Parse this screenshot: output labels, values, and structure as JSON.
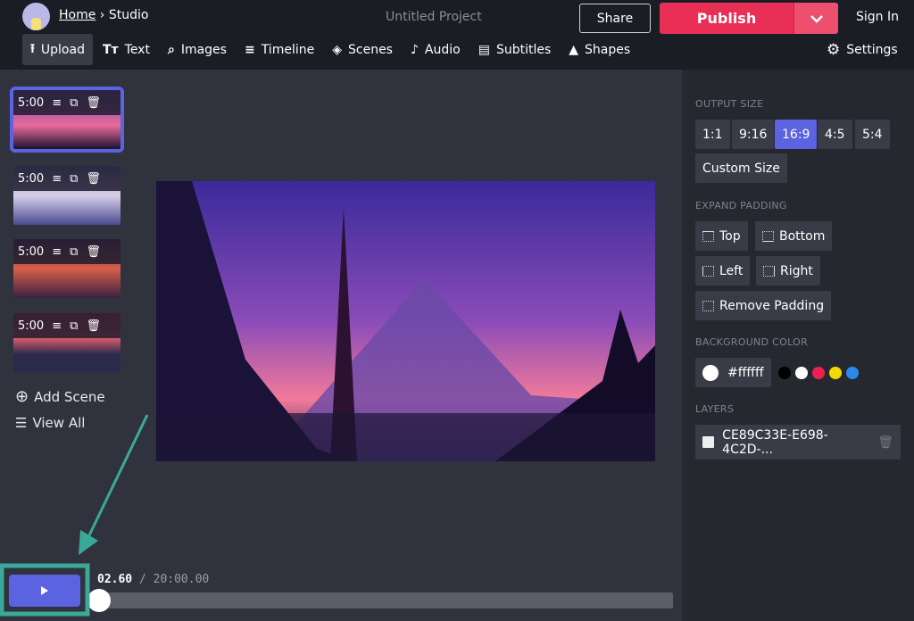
{
  "header": {
    "breadcrumb_home": "Home",
    "breadcrumb_sep": "›",
    "breadcrumb_current": "Studio",
    "project_title": "Untitled Project",
    "share_label": "Share",
    "publish_label": "Publish",
    "signin_label": "Sign In"
  },
  "toolbar": {
    "items": [
      {
        "label": "Upload",
        "icon": "upload-icon"
      },
      {
        "label": "Text",
        "icon": "text-icon"
      },
      {
        "label": "Images",
        "icon": "search-icon"
      },
      {
        "label": "Timeline",
        "icon": "timeline-icon"
      },
      {
        "label": "Scenes",
        "icon": "layers-icon"
      },
      {
        "label": "Audio",
        "icon": "music-note-icon"
      },
      {
        "label": "Subtitles",
        "icon": "subtitles-icon"
      },
      {
        "label": "Shapes",
        "icon": "shapes-icon"
      }
    ],
    "active": "Upload",
    "settings_label": "Settings"
  },
  "scenes": {
    "items": [
      {
        "duration": "5:00",
        "selected": true
      },
      {
        "duration": "5:00"
      },
      {
        "duration": "5:00"
      },
      {
        "duration": "5:00"
      }
    ],
    "add_label": "Add Scene",
    "view_all_label": "View All"
  },
  "panel": {
    "output_size_label": "OUTPUT SIZE",
    "sizes": [
      "1:1",
      "9:16",
      "16:9",
      "4:5",
      "5:4"
    ],
    "selected_size": "16:9",
    "custom_size_label": "Custom Size",
    "expand_padding_label": "EXPAND PADDING",
    "padding": {
      "top": "Top",
      "bottom": "Bottom",
      "left": "Left",
      "right": "Right",
      "remove": "Remove Padding"
    },
    "background_color_label": "BACKGROUND COLOR",
    "background_color": "#ffffff",
    "swatches": [
      "#000000",
      "#ffffff",
      "#ee2050",
      "#f5d800",
      "#2a8ae8"
    ],
    "layers_label": "LAYERS",
    "layers": [
      {
        "name": "CE89C33E-E698-4C2D-..."
      }
    ]
  },
  "player": {
    "current_time": "02.60",
    "separator": "/",
    "total_time": "20:00.00",
    "progress_percent": 0.2
  },
  "colors": {
    "accent": "#5b63e0",
    "publish": "#ea2f56",
    "annotation": "#3ba99a"
  }
}
